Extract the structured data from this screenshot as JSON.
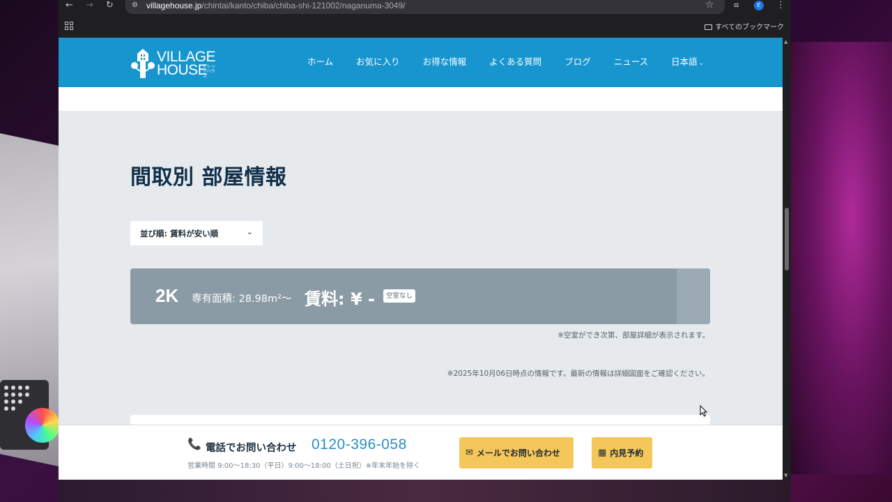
{
  "browser": {
    "url_host": "villagehouse.jp",
    "url_path": "/chintai/kanto/chiba/chiba-shi-121002/naganuma-3049/",
    "bookmarks_all_label": "すべてのブックマーク",
    "profile_initial": "E",
    "icons": [
      "back-icon",
      "forward-icon",
      "reload-icon",
      "site-settings-icon",
      "star-icon",
      "media-icon",
      "menu-icon",
      "apps-icon",
      "folder-icon"
    ]
  },
  "site": {
    "logo_line1": "VILLAGE",
    "logo_line2": "HOUSE",
    "logo_sub": "ビレッジハウス",
    "nav": [
      {
        "label": "ホーム"
      },
      {
        "label": "お気に入り"
      },
      {
        "label": "お得な情報"
      },
      {
        "label": "よくある質問"
      },
      {
        "label": "ブログ"
      },
      {
        "label": "ニュース"
      },
      {
        "label": "日本語"
      }
    ]
  },
  "main": {
    "section_title": "間取別 部屋情報",
    "sort_label": "並び順: 賃料が安い順",
    "room": {
      "type": "2K",
      "area": "専有面積: 28.98m²〜",
      "rent": "賃料: ¥ -",
      "badge": "空室なし"
    },
    "note_vacancy": "※空室ができ次第、部屋詳細が表示されます。",
    "note_date": "※2025年10月06日時点の情報です。最新の情報は詳細図面をご確認ください。"
  },
  "footer": {
    "phone_label": "電話でお問い合わせ",
    "phone_number": "0120-396-058",
    "hours": "営業時間 9:00〜18:30（平日）9:00〜18:00（土日祝）※年末年始を除く",
    "mail_button": "メールでお問い合わせ",
    "visit_button": "内見予約"
  },
  "colors": {
    "header_blue": "#1795cf",
    "title_navy": "#0f2f4a",
    "card_gray": "#8b9ba5",
    "button_yellow": "#f5c75a",
    "phone_blue": "#2a8ec4"
  }
}
